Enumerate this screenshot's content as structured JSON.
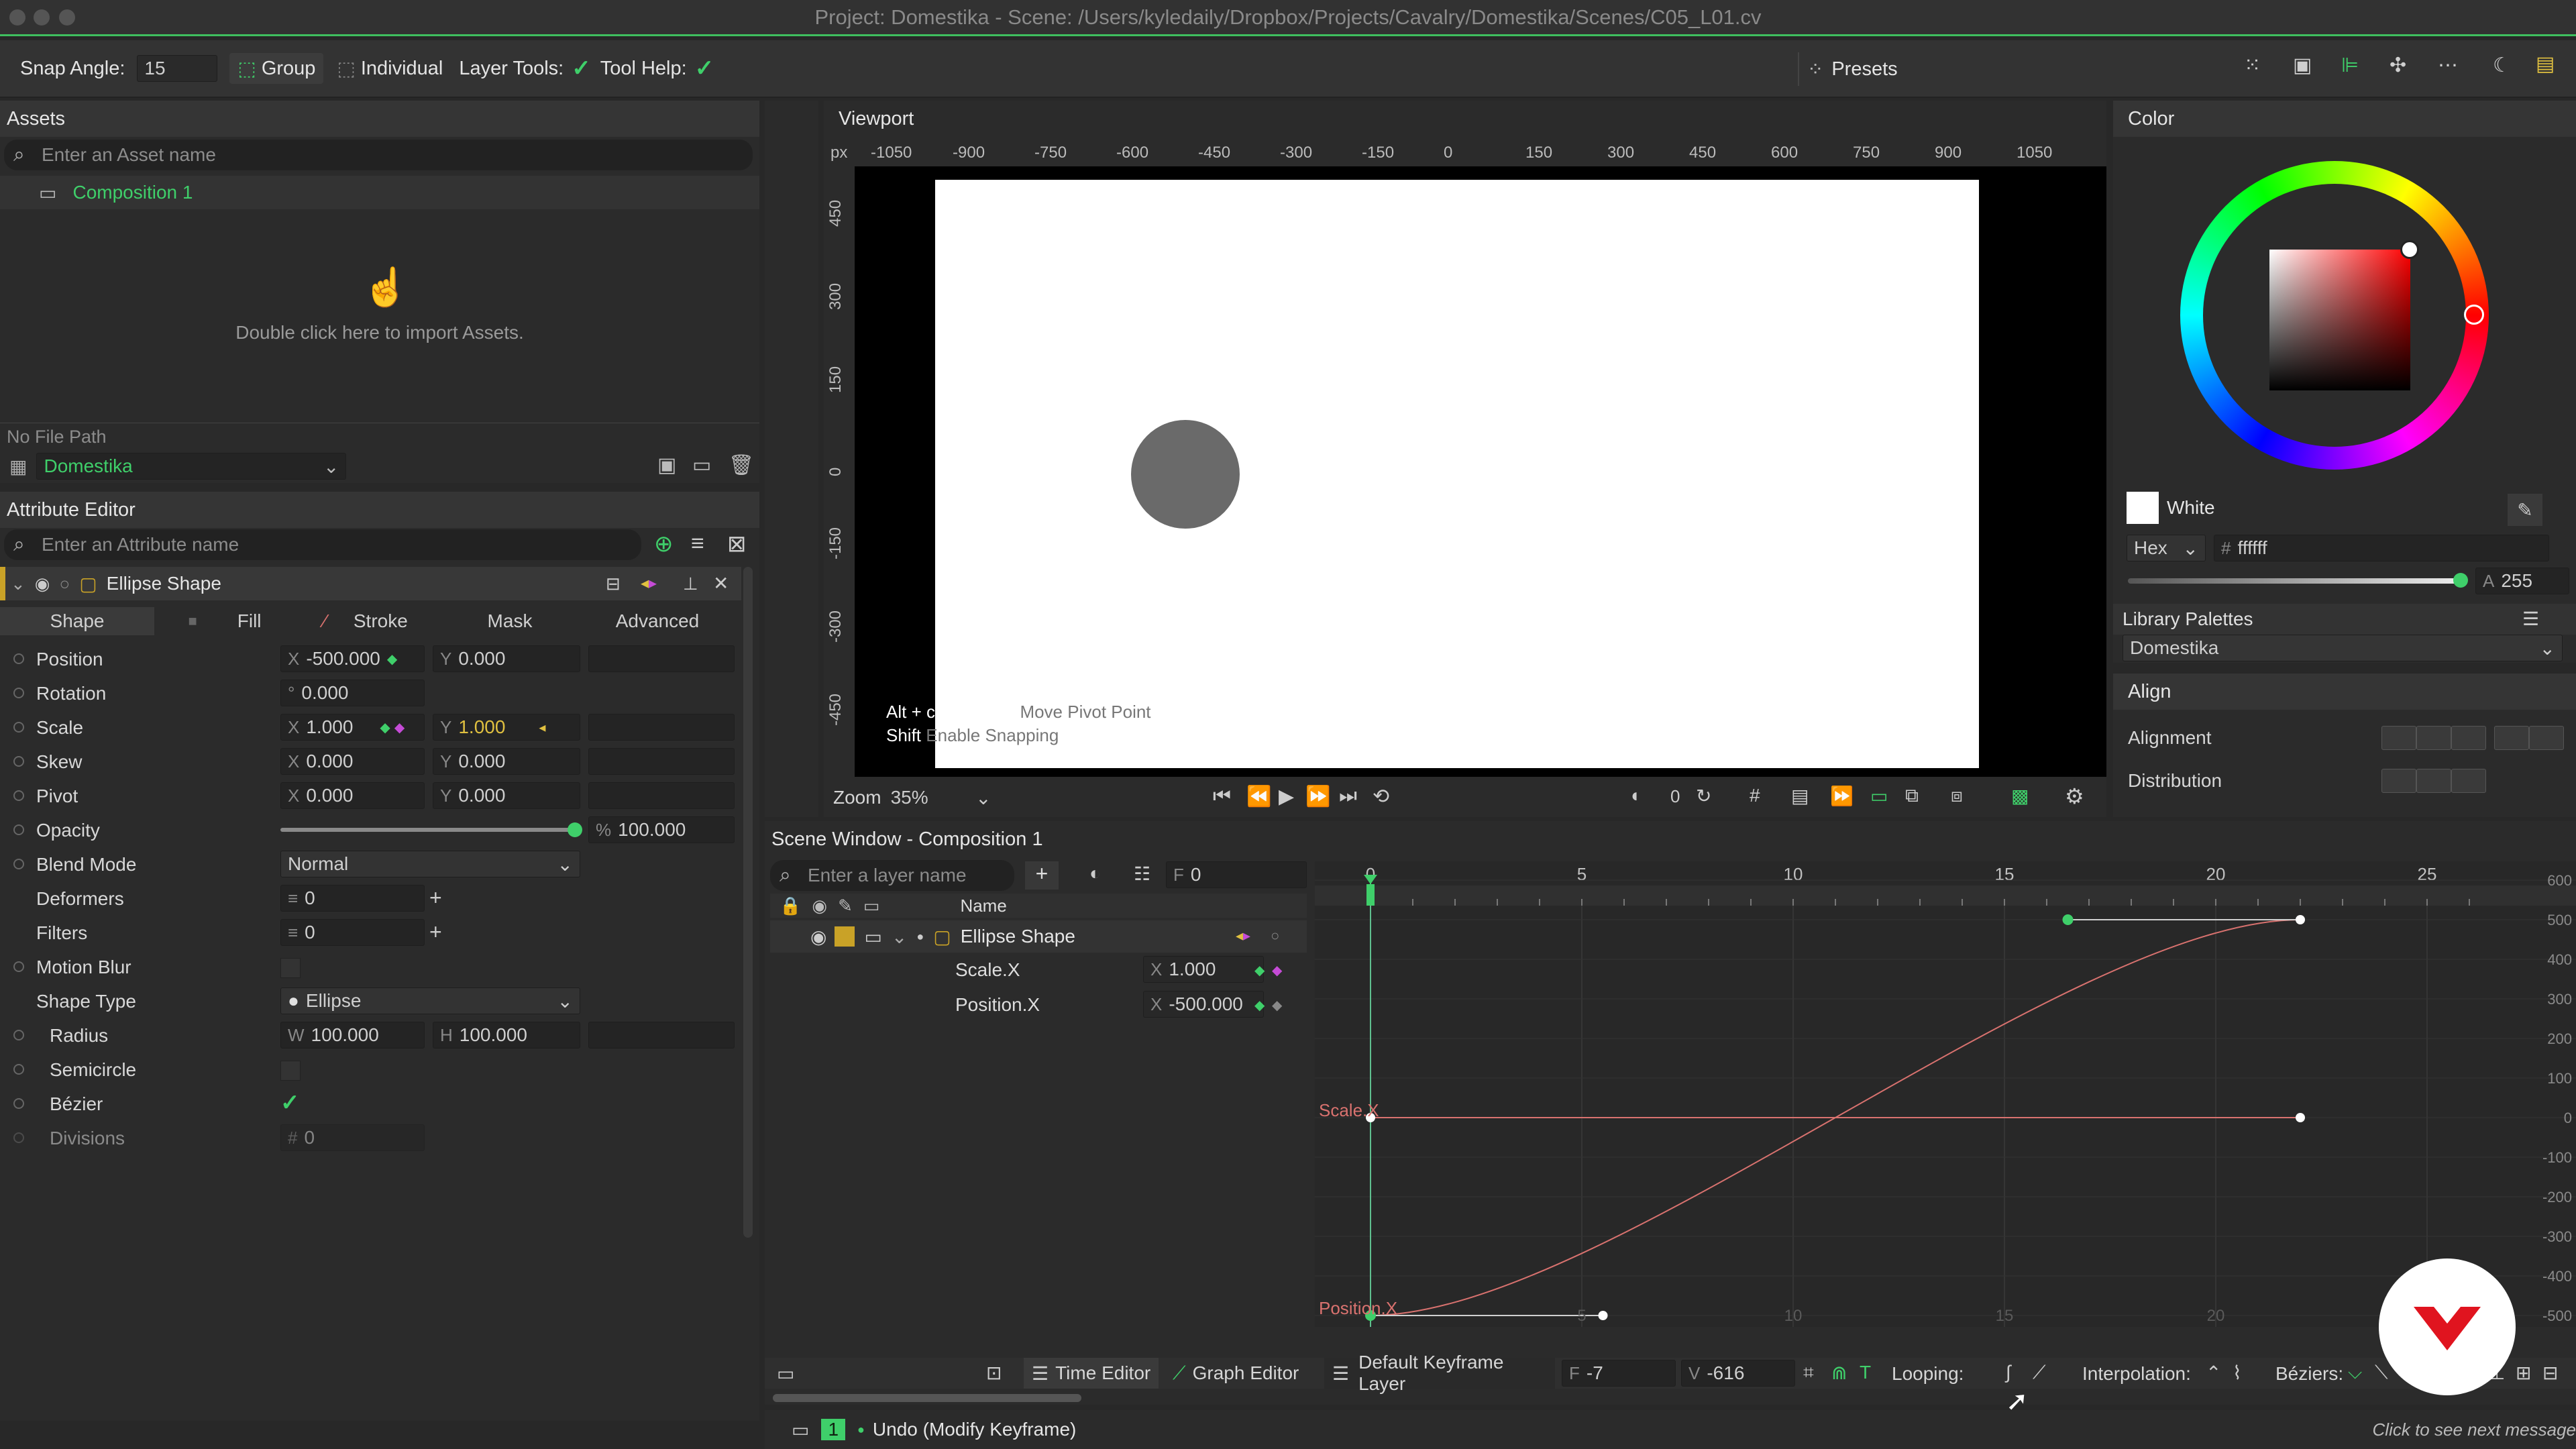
{
  "title": "Project: Domestika - Scene: /Users/kyledaily/Dropbox/Projects/Cavalry/Domestika/Scenes/C05_L01.cv",
  "toolbar": {
    "snap_label": "Snap Angle:",
    "snap_value": "15",
    "group_label": "Group",
    "individual_label": "Individual",
    "layer_tools_label": "Layer Tools:",
    "tool_help_label": "Tool Help:",
    "presets_label": "Presets"
  },
  "assets": {
    "title": "Assets",
    "search_placeholder": "Enter an Asset name",
    "composition": "Composition 1",
    "import_hint": "Double click here to import Assets.",
    "file_path": "No File Path",
    "project_select": "Domestika"
  },
  "attr_editor": {
    "title": "Attribute Editor",
    "search_placeholder": "Enter an Attribute name",
    "layer_name": "Ellipse Shape",
    "tabs": [
      "Shape",
      "Fill",
      "Stroke",
      "Mask",
      "Advanced"
    ],
    "rows": [
      {
        "label": "Position",
        "a_axis": "X",
        "a": "-500.000",
        "b_axis": "Y",
        "b": "0.000"
      },
      {
        "label": "Rotation",
        "a_axis": "°",
        "a": "0.000"
      },
      {
        "label": "Scale",
        "a_axis": "X",
        "a": "1.000",
        "b_axis": "Y",
        "b": "1.000"
      },
      {
        "label": "Skew",
        "a_axis": "X",
        "a": "0.000",
        "b_axis": "Y",
        "b": "0.000"
      },
      {
        "label": "Pivot",
        "a_axis": "X",
        "a": "0.000",
        "b_axis": "Y",
        "b": "0.000"
      },
      {
        "label": "Opacity",
        "a_axis": "%",
        "a": "100.000"
      },
      {
        "label": "Blend Mode",
        "a": "Normal"
      },
      {
        "label": "Deformers",
        "a": "0"
      },
      {
        "label": "Filters",
        "a": "0"
      },
      {
        "label": "Motion Blur"
      },
      {
        "label": "Shape Type",
        "a": "Ellipse"
      },
      {
        "label": "Radius",
        "a_axis": "W",
        "a": "100.000",
        "b_axis": "H",
        "b": "100.000"
      },
      {
        "label": "Semicircle"
      },
      {
        "label": "Bézier"
      },
      {
        "label": "Divisions",
        "a": "0"
      }
    ]
  },
  "viewport": {
    "title": "Viewport",
    "unit": "px",
    "ruler_x": [
      "-1050",
      "-900",
      "-750",
      "-600",
      "-450",
      "-300",
      "-150",
      "0",
      "150",
      "300",
      "450",
      "600",
      "750",
      "900",
      "1050"
    ],
    "ruler_y": [
      "450",
      "300",
      "150",
      "0",
      "-150",
      "-300",
      "-450"
    ],
    "hint_key1": "Alt + click + drag",
    "hint_desc1": "Move Pivot Point",
    "hint_key2": "Shift",
    "hint_desc2": "Enable Snapping",
    "zoom_label": "Zoom",
    "zoom_value": "35%",
    "frame_value": "0"
  },
  "scene": {
    "title": "Scene Window - Composition 1",
    "search_placeholder": "Enter a layer name",
    "frame_label": "F",
    "frame_value": "0",
    "name_header": "Name",
    "layer": "Ellipse Shape",
    "sub_layers": [
      {
        "name": "Scale.X",
        "axis": "X",
        "value": "1.000"
      },
      {
        "name": "Position.X",
        "axis": "X",
        "value": "-500.000"
      }
    ],
    "time_editor": "Time Editor",
    "graph_editor": "Graph Editor",
    "keyframe_layer": "Default Keyframe Layer",
    "coord_x": "-7",
    "coord_y": "-616",
    "looping_label": "Looping:",
    "interp_label": "Interpolation:",
    "beziers_label": "Béziers:"
  },
  "graph": {
    "frame_ticks": [
      "0",
      "5",
      "10",
      "15",
      "20",
      "25"
    ],
    "y_ticks": [
      "600",
      "500",
      "400",
      "300",
      "200",
      "100",
      "0",
      "-100",
      "-200",
      "-300",
      "-400",
      "-500"
    ],
    "scale_label": "Scale.X",
    "position_label": "Position.X",
    "bottom_ticks": [
      "5",
      "10",
      "15",
      "20"
    ]
  },
  "color": {
    "title": "Color",
    "swatch_name": "White",
    "mode": "Hex",
    "hex": "ffffff",
    "alpha_label": "A",
    "alpha": "255",
    "palettes_label": "Library Palettes",
    "palette": "Domestika"
  },
  "align": {
    "title": "Align",
    "alignment_label": "Alignment",
    "distribution_label": "Distribution"
  },
  "status": {
    "undo_count": "1",
    "message": "Undo (Modify Keyframe)",
    "right_message": "Click to see next message"
  },
  "colors": {
    "accent": "#3fcf6a",
    "keyframe_pink": "#c54bd6",
    "curve": "#d9726f",
    "brand_red": "#e0141f"
  }
}
